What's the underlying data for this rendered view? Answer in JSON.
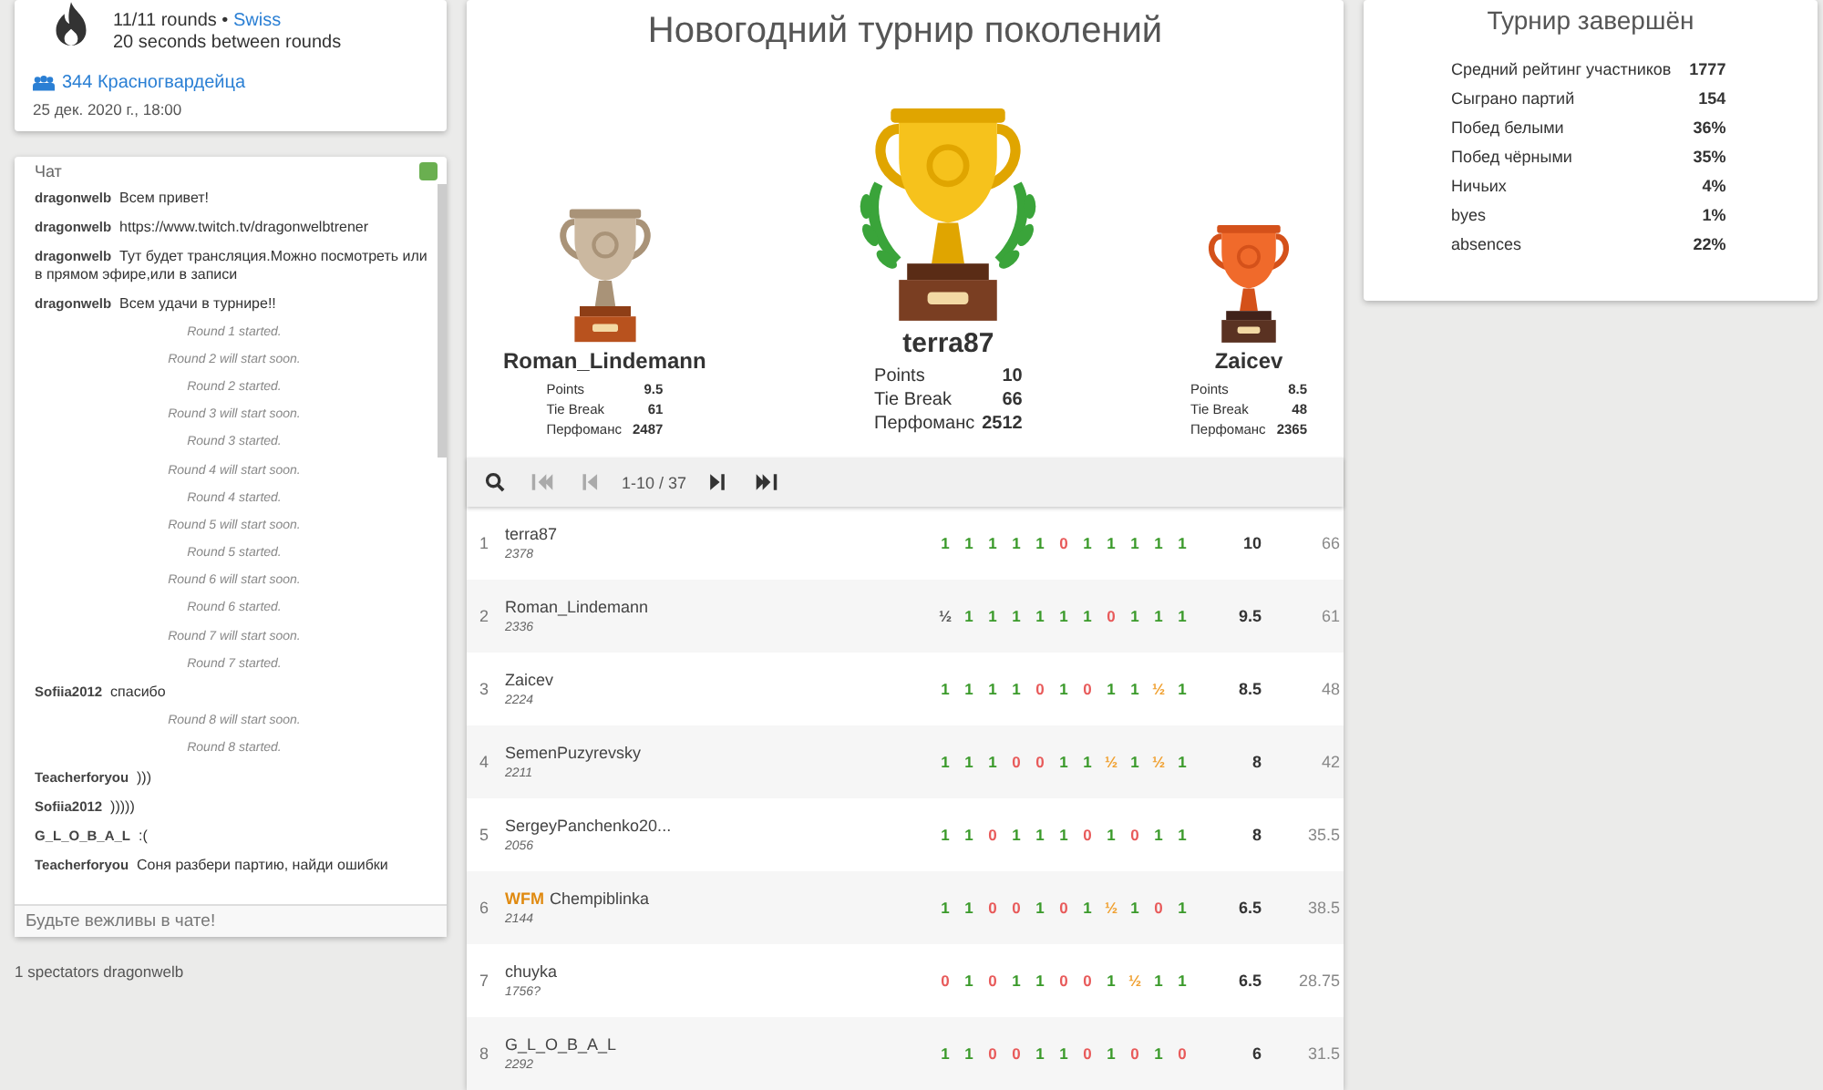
{
  "info": {
    "rounds": "11/11 rounds •",
    "system": "Swiss",
    "interval": "20 seconds between rounds",
    "team": "344 Красногвардейца",
    "date": "25 дек. 2020 г., 18:00"
  },
  "chat": {
    "title": "Чат",
    "placeholder": "Будьте вежливы в чате!",
    "messages": [
      {
        "kind": "user",
        "user": "dragonwelb",
        "text": "Всем привет!"
      },
      {
        "kind": "user",
        "user": "dragonwelb",
        "text": "https://www.twitch.tv/dragonwelbtrener"
      },
      {
        "kind": "user",
        "user": "dragonwelb",
        "text": "Тут будет трансляция.Можно посмотреть или в прямом эфире,или в записи"
      },
      {
        "kind": "user",
        "user": "dragonwelb",
        "text": "Всем удачи в турнире!!"
      },
      {
        "kind": "system",
        "text": "Round 1 started."
      },
      {
        "kind": "system",
        "text": "Round 2 will start soon."
      },
      {
        "kind": "system",
        "text": "Round 2 started."
      },
      {
        "kind": "system",
        "text": "Round 3 will start soon."
      },
      {
        "kind": "system",
        "text": "Round 3 started."
      },
      {
        "kind": "system",
        "text": "Round 4 will start soon."
      },
      {
        "kind": "system",
        "text": "Round 4 started."
      },
      {
        "kind": "system",
        "text": "Round 5 will start soon."
      },
      {
        "kind": "system",
        "text": "Round 5 started."
      },
      {
        "kind": "system",
        "text": "Round 6 will start soon."
      },
      {
        "kind": "system",
        "text": "Round 6 started."
      },
      {
        "kind": "system",
        "text": "Round 7 will start soon."
      },
      {
        "kind": "system",
        "text": "Round 7 started."
      },
      {
        "kind": "user",
        "user": "Sofiia2012",
        "text": "спасибо"
      },
      {
        "kind": "system",
        "text": "Round 8 will start soon."
      },
      {
        "kind": "system",
        "text": "Round 8 started."
      },
      {
        "kind": "user",
        "user": "Teacherforyou",
        "text": ")))"
      },
      {
        "kind": "user",
        "user": "Sofiia2012",
        "text": ")))))"
      },
      {
        "kind": "user",
        "user": "G_L_O_B_A_L",
        "text": ":("
      },
      {
        "kind": "user",
        "user": "Teacherforyou",
        "text": "Соня разбери партию, найди ошибки"
      }
    ]
  },
  "spectators": "1 spectators dragonwelb",
  "tournament": {
    "title": "Новогодний турнир поколений",
    "podium": [
      {
        "kind": "second",
        "name": "Roman_Lindemann",
        "stats": [
          {
            "label": "Points",
            "value": "9.5"
          },
          {
            "label": "Tie Break",
            "value": "61"
          },
          {
            "label": "Перфоманс",
            "value": "2487"
          }
        ]
      },
      {
        "kind": "first",
        "name": "terra87",
        "stats": [
          {
            "label": "Points",
            "value": "10"
          },
          {
            "label": "Tie Break",
            "value": "66"
          },
          {
            "label": "Перфоманс",
            "value": "2512"
          }
        ]
      },
      {
        "kind": "third",
        "name": "Zaicev",
        "stats": [
          {
            "label": "Points",
            "value": "8.5"
          },
          {
            "label": "Tie Break",
            "value": "48"
          },
          {
            "label": "Перфоманс",
            "value": "2365"
          }
        ]
      }
    ],
    "pager": {
      "range": "1-10 / 37",
      "buttons": [
        {
          "kind": "first",
          "disabled": true
        },
        {
          "kind": "prev",
          "disabled": true
        },
        {
          "kind": "next",
          "disabled": false
        },
        {
          "kind": "last",
          "disabled": false
        }
      ]
    },
    "rows": [
      {
        "rank": "1",
        "name": "terra87",
        "rating": "2378",
        "results": [
          {
            "score": "1",
            "kind": "win"
          },
          {
            "score": "1",
            "kind": "win"
          },
          {
            "score": "1",
            "kind": "win"
          },
          {
            "score": "1",
            "kind": "win"
          },
          {
            "score": "1",
            "kind": "win"
          },
          {
            "score": "0",
            "kind": "loss"
          },
          {
            "score": "1",
            "kind": "win"
          },
          {
            "score": "1",
            "kind": "win"
          },
          {
            "score": "1",
            "kind": "win"
          },
          {
            "score": "1",
            "kind": "win"
          },
          {
            "score": "1",
            "kind": "win"
          }
        ],
        "points": "10",
        "tiebreak": "66"
      },
      {
        "rank": "2",
        "name": "Roman_Lindemann",
        "rating": "2336",
        "results": [
          {
            "score": "½",
            "kind": "bye"
          },
          {
            "score": "1",
            "kind": "win"
          },
          {
            "score": "1",
            "kind": "win"
          },
          {
            "score": "1",
            "kind": "win"
          },
          {
            "score": "1",
            "kind": "win"
          },
          {
            "score": "1",
            "kind": "win"
          },
          {
            "score": "1",
            "kind": "win"
          },
          {
            "score": "0",
            "kind": "loss"
          },
          {
            "score": "1",
            "kind": "win"
          },
          {
            "score": "1",
            "kind": "win"
          },
          {
            "score": "1",
            "kind": "win"
          }
        ],
        "points": "9.5",
        "tiebreak": "61"
      },
      {
        "rank": "3",
        "name": "Zaicev",
        "rating": "2224",
        "results": [
          {
            "score": "1",
            "kind": "win"
          },
          {
            "score": "1",
            "kind": "win"
          },
          {
            "score": "1",
            "kind": "win"
          },
          {
            "score": "1",
            "kind": "win"
          },
          {
            "score": "0",
            "kind": "loss"
          },
          {
            "score": "1",
            "kind": "win"
          },
          {
            "score": "0",
            "kind": "loss"
          },
          {
            "score": "1",
            "kind": "win"
          },
          {
            "score": "1",
            "kind": "win"
          },
          {
            "score": "½",
            "kind": "draw"
          },
          {
            "score": "1",
            "kind": "win"
          }
        ],
        "points": "8.5",
        "tiebreak": "48"
      },
      {
        "rank": "4",
        "name": "SemenPuzyrevsky",
        "rating": "2211",
        "results": [
          {
            "score": "1",
            "kind": "win"
          },
          {
            "score": "1",
            "kind": "win"
          },
          {
            "score": "1",
            "kind": "win"
          },
          {
            "score": "0",
            "kind": "loss"
          },
          {
            "score": "0",
            "kind": "loss"
          },
          {
            "score": "1",
            "kind": "win"
          },
          {
            "score": "1",
            "kind": "win"
          },
          {
            "score": "½",
            "kind": "draw"
          },
          {
            "score": "1",
            "kind": "win"
          },
          {
            "score": "½",
            "kind": "draw"
          },
          {
            "score": "1",
            "kind": "win"
          }
        ],
        "points": "8",
        "tiebreak": "42"
      },
      {
        "rank": "5",
        "name": "SergeyPanchenko20...",
        "rating": "2056",
        "results": [
          {
            "score": "1",
            "kind": "win"
          },
          {
            "score": "1",
            "kind": "win"
          },
          {
            "score": "0",
            "kind": "loss"
          },
          {
            "score": "1",
            "kind": "win"
          },
          {
            "score": "1",
            "kind": "win"
          },
          {
            "score": "1",
            "kind": "win"
          },
          {
            "score": "0",
            "kind": "loss"
          },
          {
            "score": "1",
            "kind": "win"
          },
          {
            "score": "0",
            "kind": "loss"
          },
          {
            "score": "1",
            "kind": "win"
          },
          {
            "score": "1",
            "kind": "win"
          }
        ],
        "points": "8",
        "tiebreak": "35.5"
      },
      {
        "rank": "6",
        "title": "WFM",
        "name": "Chempiblinka",
        "rating": "2144",
        "results": [
          {
            "score": "1",
            "kind": "win"
          },
          {
            "score": "1",
            "kind": "win"
          },
          {
            "score": "0",
            "kind": "loss"
          },
          {
            "score": "0",
            "kind": "loss"
          },
          {
            "score": "1",
            "kind": "win"
          },
          {
            "score": "0",
            "kind": "loss"
          },
          {
            "score": "1",
            "kind": "win"
          },
          {
            "score": "½",
            "kind": "draw"
          },
          {
            "score": "1",
            "kind": "win"
          },
          {
            "score": "0",
            "kind": "loss"
          },
          {
            "score": "1",
            "kind": "win"
          }
        ],
        "points": "6.5",
        "tiebreak": "38.5"
      },
      {
        "rank": "7",
        "name": "chuyka",
        "rating": "1756?",
        "results": [
          {
            "score": "0",
            "kind": "loss"
          },
          {
            "score": "1",
            "kind": "win"
          },
          {
            "score": "0",
            "kind": "loss"
          },
          {
            "score": "1",
            "kind": "win"
          },
          {
            "score": "1",
            "kind": "win"
          },
          {
            "score": "0",
            "kind": "loss"
          },
          {
            "score": "0",
            "kind": "loss"
          },
          {
            "score": "1",
            "kind": "win"
          },
          {
            "score": "½",
            "kind": "draw"
          },
          {
            "score": "1",
            "kind": "win"
          },
          {
            "score": "1",
            "kind": "win"
          }
        ],
        "points": "6.5",
        "tiebreak": "28.75"
      },
      {
        "rank": "8",
        "name": "G_L_O_B_A_L",
        "rating": "2292",
        "results": [
          {
            "score": "1",
            "kind": "win"
          },
          {
            "score": "1",
            "kind": "win"
          },
          {
            "score": "0",
            "kind": "loss"
          },
          {
            "score": "0",
            "kind": "loss"
          },
          {
            "score": "1",
            "kind": "win"
          },
          {
            "score": "1",
            "kind": "win"
          },
          {
            "score": "0",
            "kind": "loss"
          },
          {
            "score": "1",
            "kind": "win"
          },
          {
            "score": "0",
            "kind": "loss"
          },
          {
            "score": "1",
            "kind": "win"
          },
          {
            "score": "0",
            "kind": "loss"
          }
        ],
        "points": "6",
        "tiebreak": "31.5"
      }
    ]
  },
  "summary": {
    "title": "Турнир завершён",
    "stats": [
      {
        "label": "Средний рейтинг участников",
        "value": "1777"
      },
      {
        "label": "Сыграно партий",
        "value": "154"
      },
      {
        "label": "Побед белыми",
        "value": "36%"
      },
      {
        "label": "Побед чёрными",
        "value": "35%"
      },
      {
        "label": "Ничьих",
        "value": "4%"
      },
      {
        "label": "byes",
        "value": "1%"
      },
      {
        "label": "absences",
        "value": "22%"
      }
    ]
  }
}
